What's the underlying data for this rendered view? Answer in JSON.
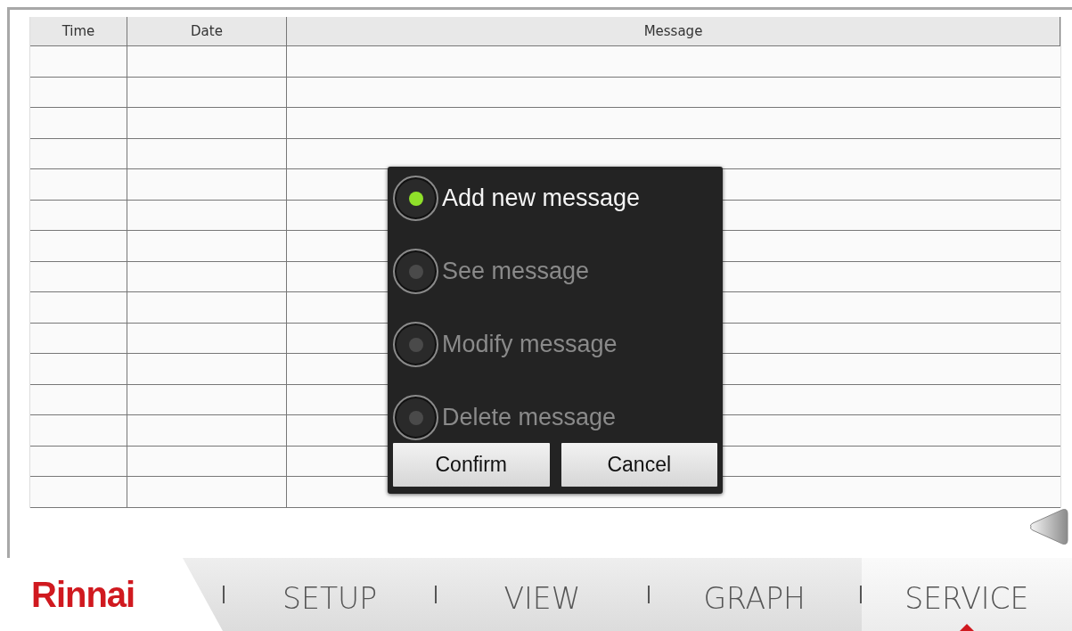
{
  "table": {
    "columns": [
      "Time",
      "Date",
      "Message"
    ],
    "rows": [
      {},
      {},
      {},
      {},
      {},
      {},
      {},
      {},
      {},
      {},
      {},
      {},
      {},
      {},
      {}
    ]
  },
  "dialog": {
    "options": [
      {
        "label": "Add new message",
        "selected": true
      },
      {
        "label": "See message",
        "selected": false
      },
      {
        "label": "Modify message",
        "selected": false
      },
      {
        "label": "Delete message",
        "selected": false
      }
    ],
    "buttons": [
      "Confirm",
      "Cancel"
    ]
  },
  "nav": {
    "logo": "Rinnai",
    "tabs": [
      {
        "label": "SETUP",
        "selected": false
      },
      {
        "label": "VIEW",
        "selected": false
      },
      {
        "label": "GRAPH",
        "selected": false
      },
      {
        "label": "SERVICE",
        "selected": true
      }
    ]
  }
}
